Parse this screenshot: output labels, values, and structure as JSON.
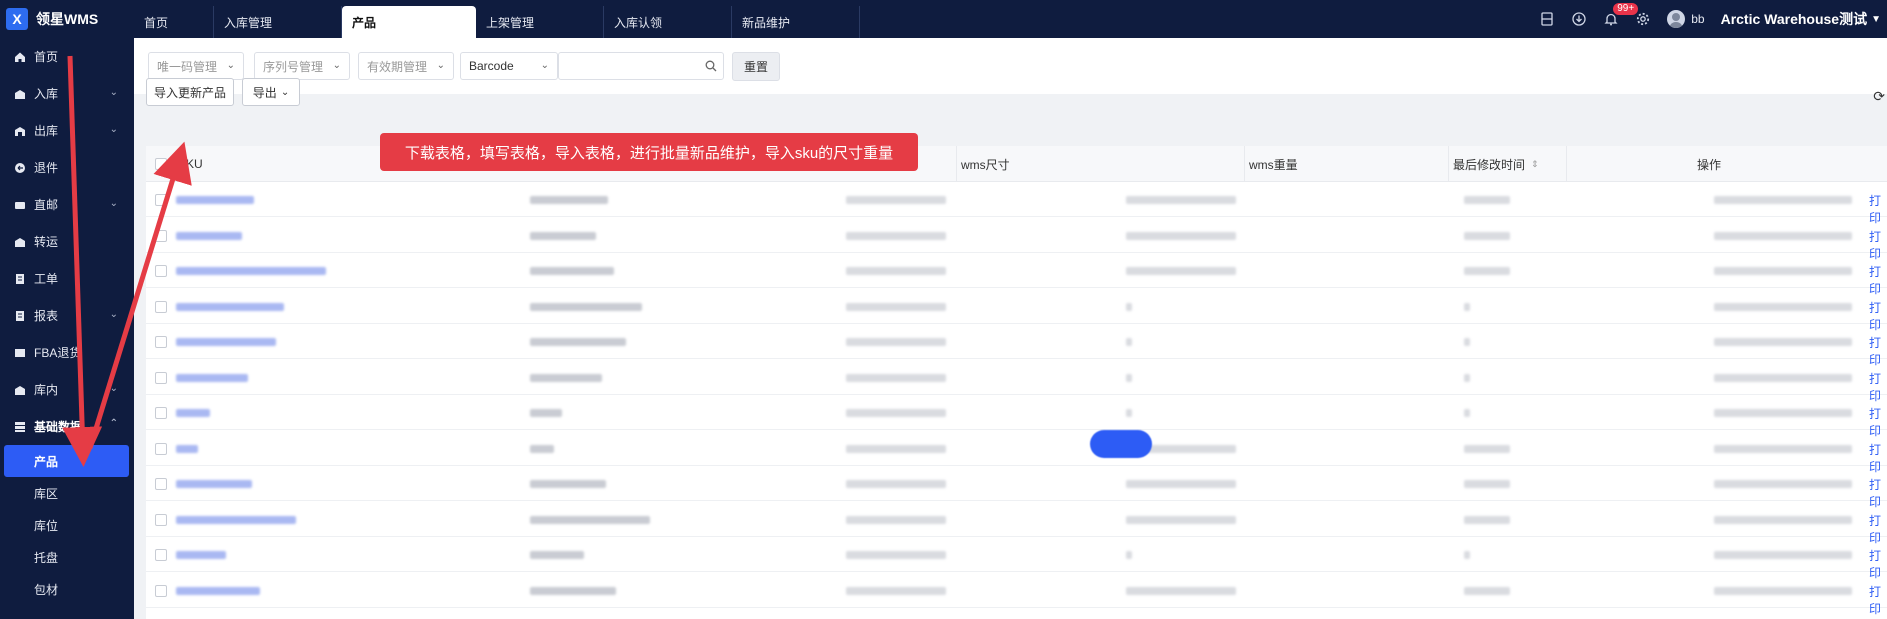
{
  "app": {
    "name": "领星WMS",
    "logo_letter": "X"
  },
  "tabs": [
    {
      "label": "首页"
    },
    {
      "label": "入库管理"
    },
    {
      "label": "产品",
      "active": true
    },
    {
      "label": "上架管理"
    },
    {
      "label": "入库认领"
    },
    {
      "label": "新品维护"
    }
  ],
  "header": {
    "notifications_badge": "99+",
    "user": "bb",
    "warehouse": "Arctic Warehouse测试"
  },
  "sidebar": {
    "items": [
      {
        "label": "首页",
        "icon": "home-icon"
      },
      {
        "label": "入库",
        "icon": "inbound-icon",
        "expandable": true
      },
      {
        "label": "出库",
        "icon": "outbound-icon",
        "expandable": true
      },
      {
        "label": "退件",
        "icon": "return-icon"
      },
      {
        "label": "直邮",
        "icon": "direct-mail-icon",
        "expandable": true
      },
      {
        "label": "转运",
        "icon": "transfer-icon"
      },
      {
        "label": "工单",
        "icon": "ticket-icon"
      },
      {
        "label": "报表",
        "icon": "report-icon",
        "expandable": true
      },
      {
        "label": "FBA退货",
        "icon": "fba-icon"
      },
      {
        "label": "库内",
        "icon": "warehouse-icon",
        "expandable": true
      },
      {
        "label": "基础数据",
        "icon": "basic-data-icon",
        "expanded": true
      }
    ],
    "sub_items": [
      {
        "label": "产品",
        "active": true
      },
      {
        "label": "库区"
      },
      {
        "label": "库位"
      },
      {
        "label": "托盘"
      },
      {
        "label": "包材"
      }
    ]
  },
  "filters": {
    "unique_code": "唯一码管理",
    "serial_no": "序列号管理",
    "expiry": "有效期管理",
    "search_type": "Barcode",
    "search_value": "",
    "reset_label": "重置"
  },
  "actions": {
    "import_label": "导入更新产品",
    "export_label": "导出"
  },
  "table": {
    "columns": [
      "SKU",
      "wms尺寸",
      "wms重量",
      "最后修改时间",
      "操作"
    ],
    "row_action": "打印",
    "row_count": 12
  },
  "annotation": {
    "text": "下载表格，填写表格，导入表格，进行批量新品维护，导入sku的尺寸重量"
  },
  "colors": {
    "nav_bg": "#0f1c3f",
    "accent": "#2d5cf5",
    "annotation_bg": "#e53c45",
    "badge": "#e9334a"
  }
}
